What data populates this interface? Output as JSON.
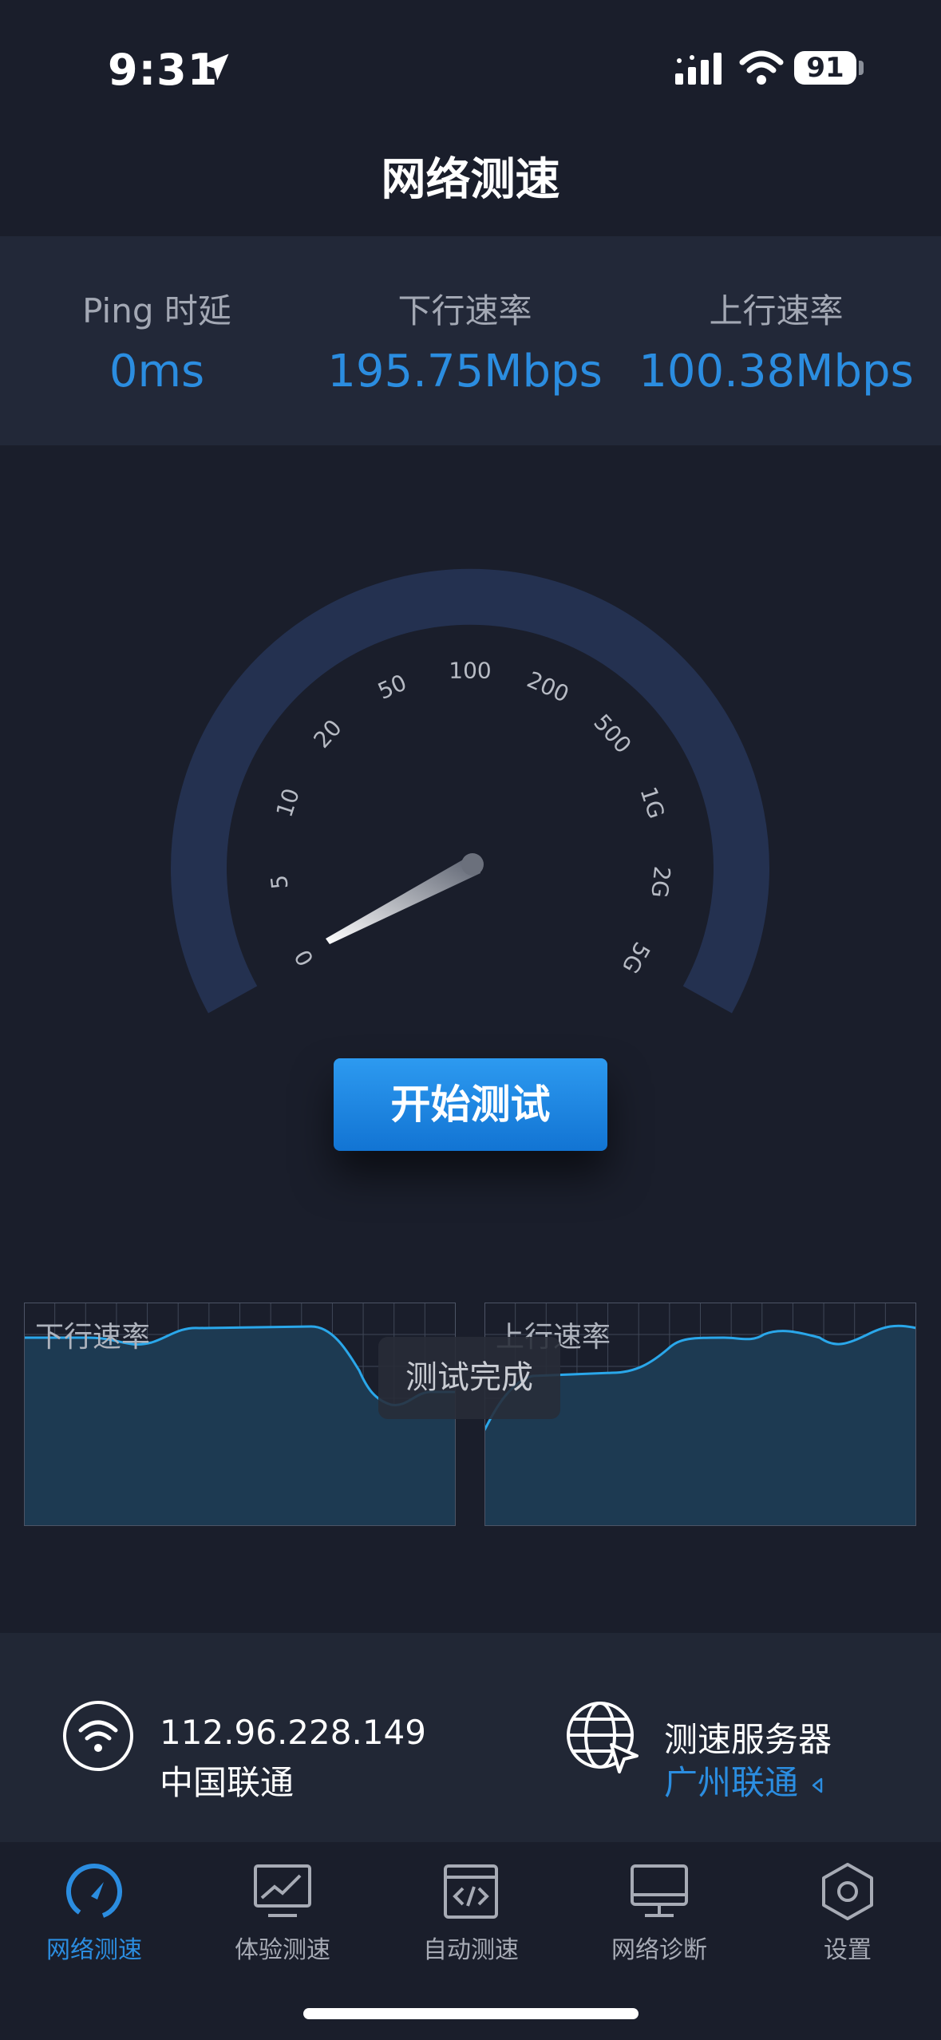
{
  "status_bar": {
    "time": "9:31",
    "battery": "91"
  },
  "header": {
    "title": "网络测速"
  },
  "stats": [
    {
      "label": "Ping 时延",
      "value": "0ms"
    },
    {
      "label": "下行速率",
      "value": "195.75Mbps"
    },
    {
      "label": "上行速率",
      "value": "100.38Mbps"
    }
  ],
  "gauge": {
    "scale_labels": [
      "0",
      "5",
      "10",
      "20",
      "50",
      "100",
      "200",
      "500",
      "1G",
      "2G",
      "5G"
    ]
  },
  "start_button": {
    "label": "开始测试"
  },
  "charts": {
    "download_label": "下行速率",
    "upload_label": "上行速率"
  },
  "toast": {
    "text": "测试完成"
  },
  "network": {
    "ip": "112.96.228.149",
    "carrier": "中国联通"
  },
  "server": {
    "title": "测速服务器",
    "name": "广州联通"
  },
  "tabs": [
    {
      "label": "网络测速",
      "icon": "speedometer-icon",
      "active": true
    },
    {
      "label": "体验测速",
      "icon": "monitor-chart-icon",
      "active": false
    },
    {
      "label": "自动测速",
      "icon": "code-window-icon",
      "active": false
    },
    {
      "label": "网络诊断",
      "icon": "monitor-icon",
      "active": false
    },
    {
      "label": "设置",
      "icon": "hexagon-settings-icon",
      "active": false
    }
  ],
  "colors": {
    "accent": "#2b8de0",
    "background": "#1a1e2b",
    "panel": "#222838",
    "gauge_ring": "#243150"
  }
}
